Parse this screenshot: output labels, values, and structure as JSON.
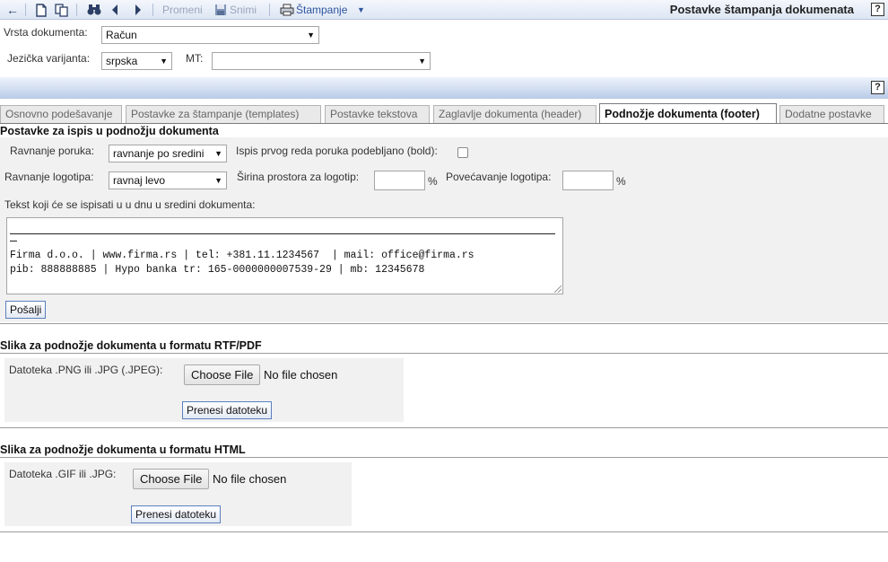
{
  "toolbar": {
    "back_icon": "back-arrow-icon",
    "new_icon": "new-document-icon",
    "copy_icon": "copy-document-icon",
    "find_icon": "binoculars-icon",
    "prev_icon": "previous-icon",
    "next_icon": "next-icon",
    "edit_label": "Promeni",
    "save_label": "Snimi",
    "print_label": "Štampanje",
    "page_title": "Postavke štampanja dokumenata",
    "help_label": "?"
  },
  "header_form": {
    "doc_type_label": "Vrsta dokumenta:",
    "doc_type_value": "Račun",
    "lang_label": "Jezička varijanta:",
    "lang_value": "srpska",
    "mt_label": "MT:",
    "mt_value": ""
  },
  "band": {
    "help_label": "?"
  },
  "tabs": [
    {
      "label": "Osnovno podešavanje",
      "active": false
    },
    {
      "label": "Postavke za štampanje (templates)",
      "active": false
    },
    {
      "label": "Postavke tekstova",
      "active": false
    },
    {
      "label": "Zaglavlje dokumenta (header)",
      "active": false
    },
    {
      "label": "Podnožje dokumenta (footer)",
      "active": true
    },
    {
      "label": "Dodatne postavke",
      "active": false
    }
  ],
  "footer_settings": {
    "title": "Postavke za ispis u podnožju dokumenta",
    "msg_align_label": "Ravnanje poruka:",
    "msg_align_value": "ravnanje po sredini",
    "bold_label": "Ispis prvog reda poruka podebljano (bold):",
    "bold_checked": false,
    "logo_align_label": "Ravnanje logotipa:",
    "logo_align_value": "ravnaj levo",
    "logo_width_label": "Širina prostora za logotip:",
    "logo_width_value": "",
    "logo_width_unit": "%",
    "logo_zoom_label": "Povećavanje logotipa:",
    "logo_zoom_value": "",
    "logo_zoom_unit": "%",
    "text_label": "Tekst koji će se ispisati u u dnu u sredini dokumenta:",
    "text_lines": [
      "Firma d.o.o. | www.firma.rs | tel: +381.11.1234567  | mail: office@firma.rs",
      "pib: 888888885 | Hypo banka tr: 165-0000000007539-29 | mb: 12345678"
    ],
    "submit_label": "Pošalji"
  },
  "rtf_image": {
    "title": "Slika za podnožje dokumenta u formatu RTF/PDF",
    "file_label": "Datoteka .PNG ili .JPG (.JPEG):",
    "choose_label": "Choose File",
    "no_file_label": "No file chosen",
    "upload_label": "Prenesi datoteku"
  },
  "html_image": {
    "title": "Slika za podnožje dokumenta u formatu HTML",
    "file_label": "Datoteka .GIF ili .JPG:",
    "choose_label": "Choose File",
    "no_file_label": "No file chosen",
    "upload_label": "Prenesi datoteku"
  }
}
